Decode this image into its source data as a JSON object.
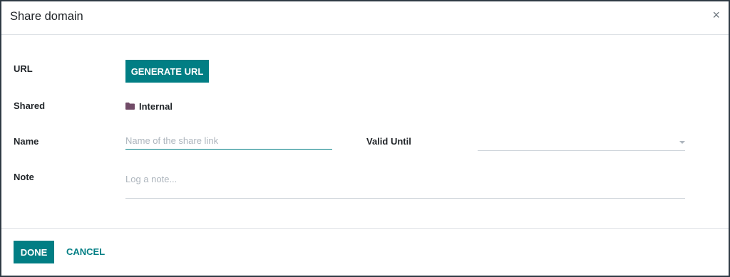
{
  "dialog": {
    "title": "Share domain",
    "close_glyph": "×"
  },
  "form": {
    "url_label": "URL",
    "generate_url_label": "GENERATE URL",
    "shared_label": "Shared",
    "shared_value": "Internal",
    "shared_icon": "folder-icon",
    "name_label": "Name",
    "name_placeholder": "Name of the share link",
    "name_value": "",
    "valid_until_label": "Valid Until",
    "valid_until_value": "",
    "note_label": "Note",
    "note_placeholder": "Log a note...",
    "note_value": ""
  },
  "footer": {
    "done_label": "DONE",
    "cancel_label": "CANCEL"
  },
  "colors": {
    "primary": "#017e84",
    "folder": "#714b67"
  }
}
